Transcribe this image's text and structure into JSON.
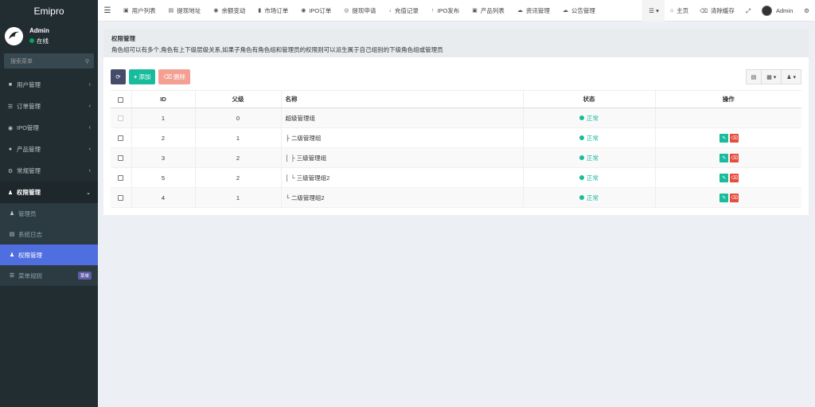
{
  "sidebar": {
    "brand": "Emipro",
    "user": {
      "name": "Admin",
      "status": "在线"
    },
    "search_placeholder": "搜索菜单",
    "menu": [
      {
        "label": "用户管理",
        "icon": "user-icon"
      },
      {
        "label": "订单管理",
        "icon": "list-icon"
      },
      {
        "label": "IPO管理",
        "icon": "eye-icon"
      },
      {
        "label": "产品管理",
        "icon": "product-icon"
      },
      {
        "label": "常规管理",
        "icon": "cogs-icon"
      },
      {
        "label": "权限管理",
        "icon": "group-icon"
      }
    ],
    "submenu": [
      {
        "label": "管理员",
        "icon": "user-icon"
      },
      {
        "label": "系统日志",
        "icon": "log-icon"
      },
      {
        "label": "权限管理",
        "icon": "group-icon"
      },
      {
        "label": "菜单规则",
        "icon": "bars-icon",
        "badge": "菜单"
      }
    ]
  },
  "topbar": {
    "tabs": [
      {
        "label": "用户列表",
        "icon": "id-card-icon"
      },
      {
        "label": "提现地址",
        "icon": "address-icon"
      },
      {
        "label": "余额变动",
        "icon": "money-icon"
      },
      {
        "label": "市场订单",
        "icon": "bookmark-icon"
      },
      {
        "label": "IPO订单",
        "icon": "eye-icon"
      },
      {
        "label": "提现申请",
        "icon": "compass-icon"
      },
      {
        "label": "充值记录",
        "icon": "arrow-down-icon"
      },
      {
        "label": "IPO发布",
        "icon": "arrow-up-icon"
      },
      {
        "label": "产品列表",
        "icon": "product-icon"
      },
      {
        "label": "资讯管理",
        "icon": "cloud-icon"
      },
      {
        "label": "公告管理",
        "icon": "cloud-icon"
      }
    ],
    "home": "主页",
    "clear_cache": "清除缓存",
    "user": "Admin"
  },
  "header": {
    "title": "权限管理",
    "desc": "角色组可以有多个,角色有上下级层级关系,如果子角色有角色组和管理员的权限则可以派生属于自己组别的下级角色组或管理员"
  },
  "toolbar": {
    "add": "添加",
    "delete": "删除"
  },
  "table": {
    "columns": [
      "ID",
      "父级",
      "名称",
      "状态",
      "操作"
    ],
    "rows": [
      {
        "id": "1",
        "pid": "0",
        "name": "超级管理组",
        "status": "正常",
        "ops": false,
        "disabled": true
      },
      {
        "id": "2",
        "pid": "1",
        "name": "├ 二级管理组",
        "status": "正常",
        "ops": true
      },
      {
        "id": "3",
        "pid": "2",
        "name": "│ ├ 三级管理组",
        "status": "正常",
        "ops": true
      },
      {
        "id": "5",
        "pid": "2",
        "name": "│ └ 三级管理组2",
        "status": "正常",
        "ops": true
      },
      {
        "id": "4",
        "pid": "1",
        "name": "└ 二级管理组2",
        "status": "正常",
        "ops": true
      }
    ]
  }
}
